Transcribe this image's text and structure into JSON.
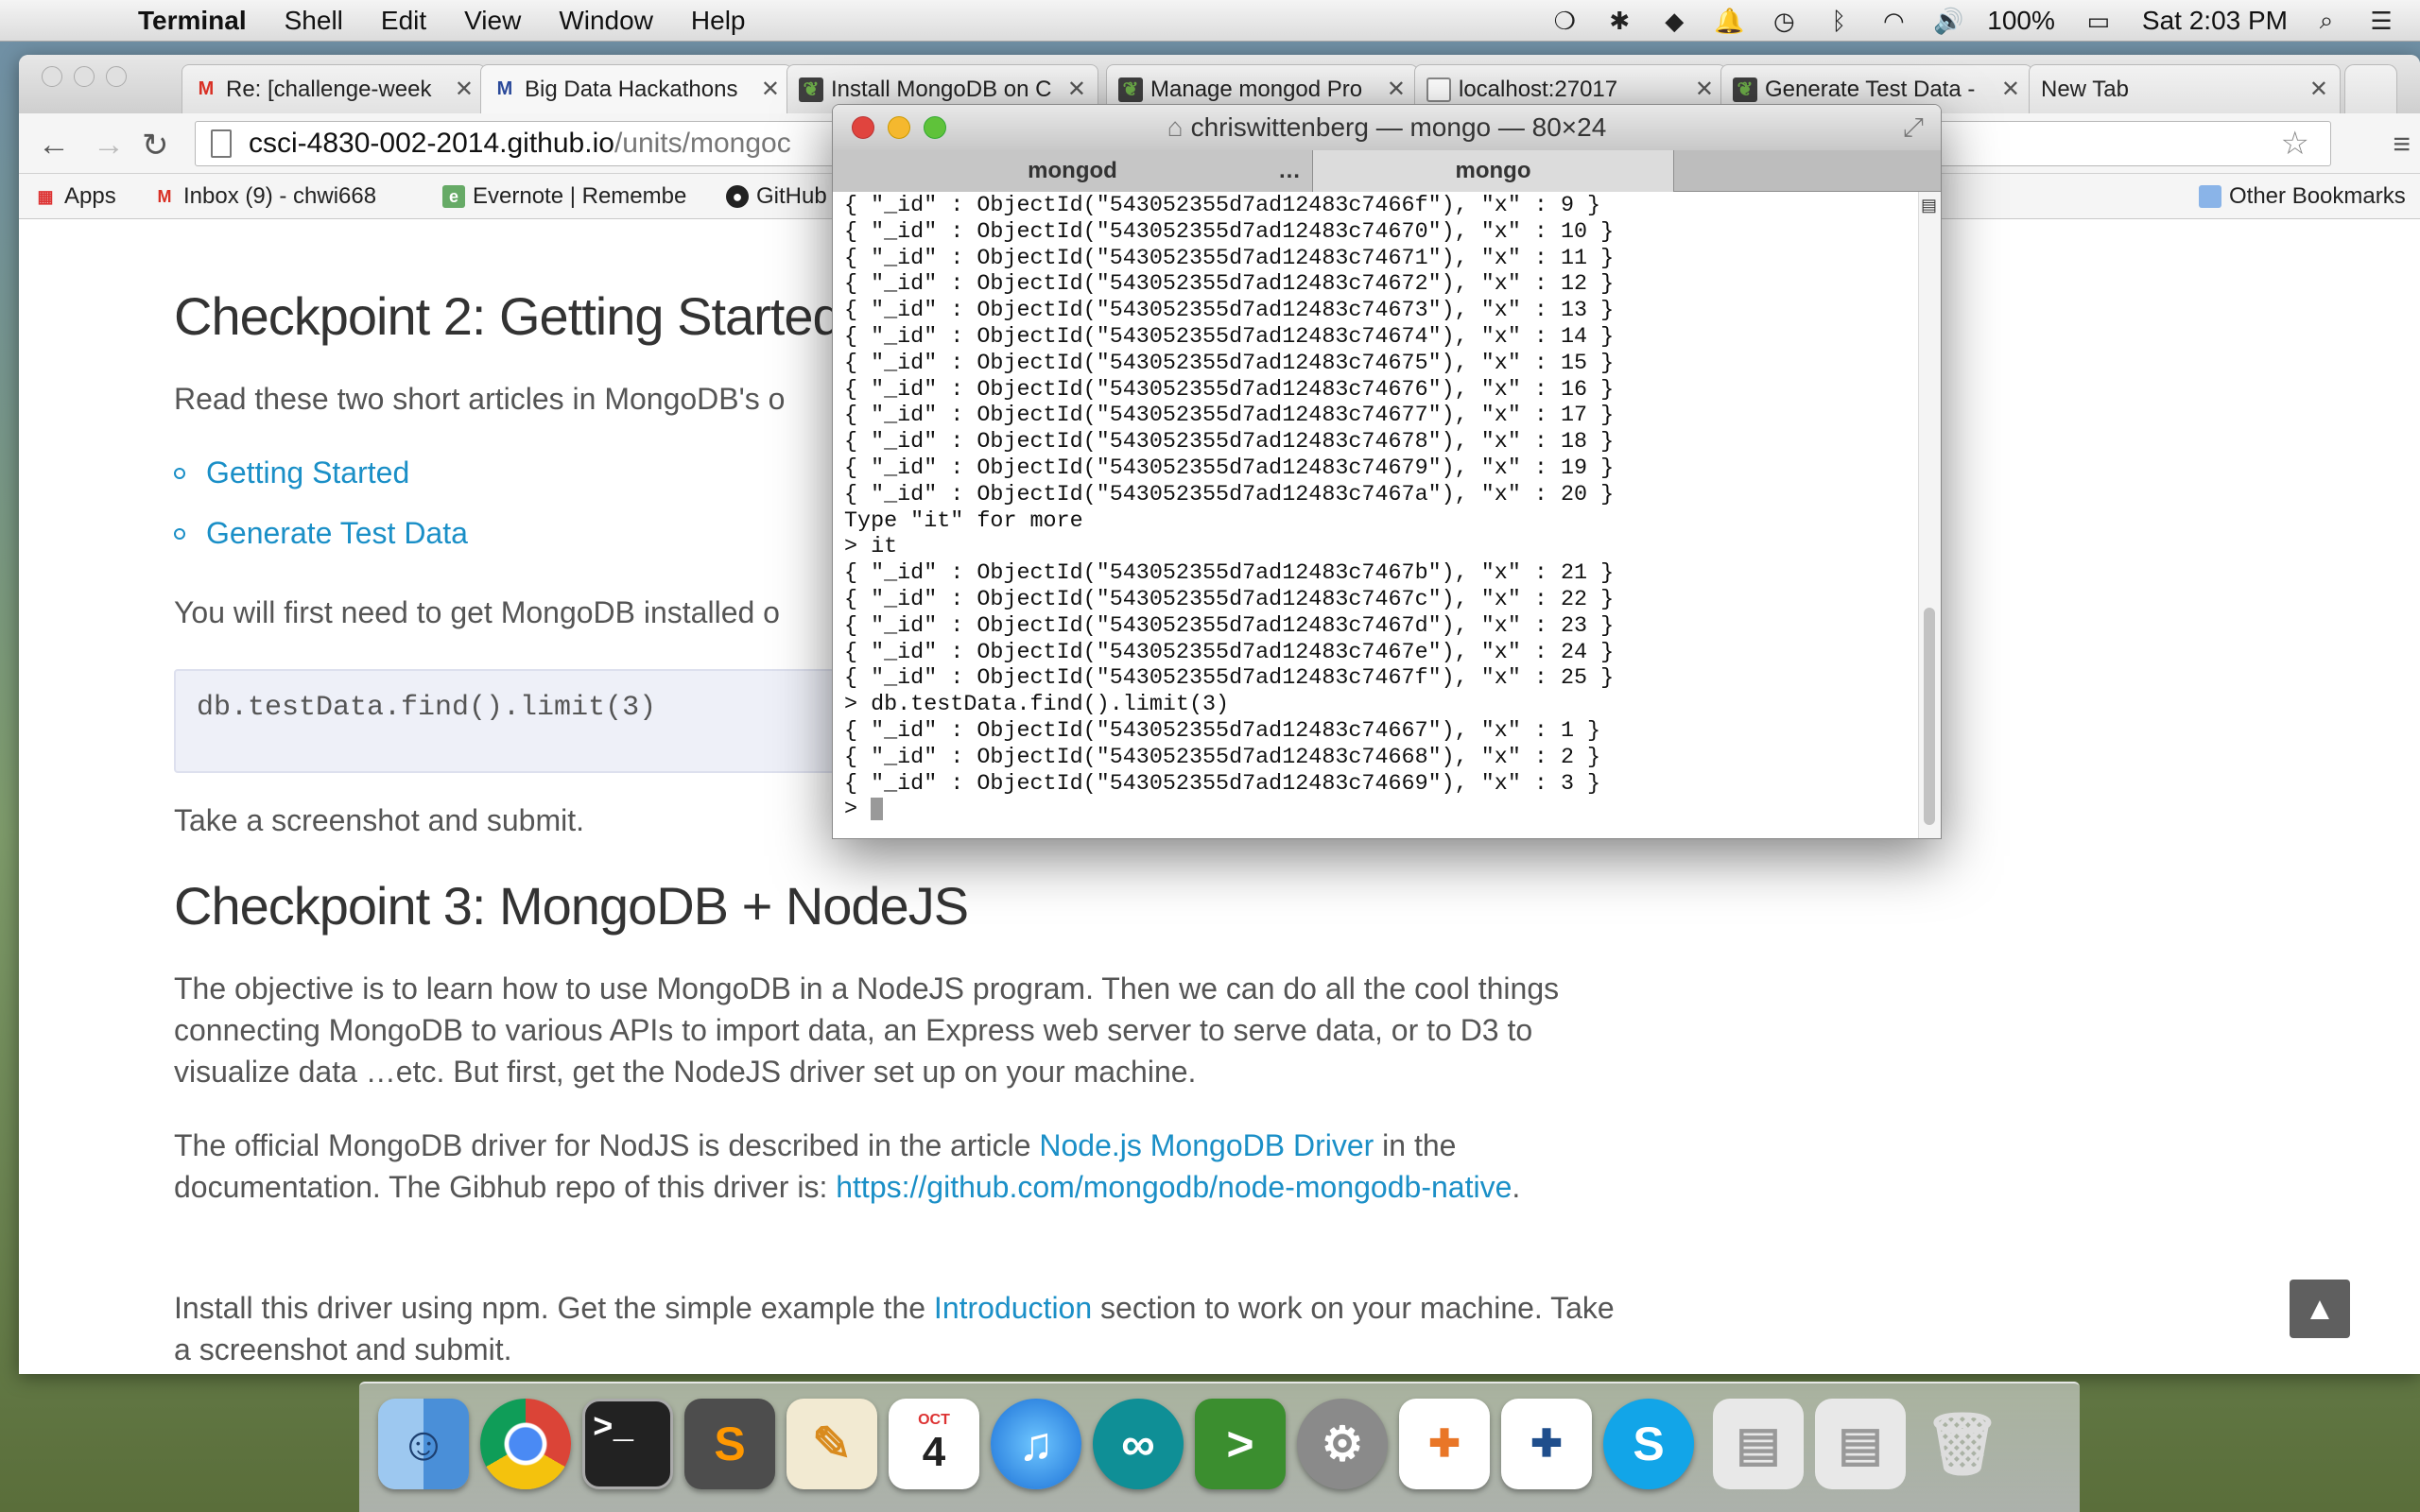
{
  "menubar": {
    "app_name": "Terminal",
    "items": [
      "Shell",
      "Edit",
      "View",
      "Window",
      "Help"
    ],
    "battery": "100%",
    "clock": "Sat 2:03 PM"
  },
  "chrome": {
    "tabs": [
      {
        "label": "Re: [challenge-week",
        "icon": "gmail-icon"
      },
      {
        "label": "Big Data Hackathons",
        "icon": "medium-icon"
      },
      {
        "label": "Install MongoDB on C",
        "icon": "mongodb-leaf-icon"
      },
      {
        "label": "Manage mongod Pro",
        "icon": "mongodb-leaf-icon"
      },
      {
        "label": "localhost:27017",
        "icon": "document-icon"
      },
      {
        "label": "Generate Test Data -",
        "icon": "mongodb-leaf-icon"
      },
      {
        "label": "New Tab",
        "icon": ""
      }
    ],
    "url_host": "csci-4830-002-2014.github.io",
    "url_path": "/units/mongoc",
    "bookmarks": [
      {
        "label": "Apps",
        "icon": "apps-grid-icon"
      },
      {
        "label": "Inbox (9) - chwi668",
        "icon": "gmail-icon"
      },
      {
        "label": "Evernote | Remembe",
        "icon": "evernote-icon"
      },
      {
        "label": "GitHub",
        "icon": "github-icon"
      },
      {
        "label": "Other Bookmarks",
        "icon": "folder-icon"
      }
    ]
  },
  "page": {
    "checkpoint2_title": "Checkpoint 2: Getting Started",
    "checkpoint2_intro": "Read these two short articles in MongoDB's o",
    "links": [
      "Getting Started",
      "Generate Test Data"
    ],
    "install_text": "You will first need to get MongoDB installed o",
    "code": "db.testData.find().limit(3)",
    "screenshot_text": "Take a screenshot and submit.",
    "checkpoint3_title": "Checkpoint 3: MongoDB + NodeJS",
    "objective_text": "The objective is to learn how to use MongoDB in a NodeJS program. Then we can do all the cool things connecting MongoDB to various APIs to import data, an Express web server to serve data, or to D3 to visualize data …etc. But first, get the NodeJS driver set up on your machine.",
    "driver_text_1": "The official MongoDB driver for NodJS is described in the article ",
    "driver_link": "Node.js MongoDB Driver",
    "driver_text_2": " in the documentation. The Gibhub repo of this driver is: ",
    "repo_link": "https://github.com/mongodb/node-mongodb-native",
    "driver_text_3": ".",
    "install_driver_1": "Install this driver using npm. Get the simple example the ",
    "intro_link": "Introduction",
    "install_driver_2": " section to work on your machine. Take a screenshot and submit."
  },
  "terminal": {
    "title": "chriswittenberg — mongo — 80×24",
    "tabs": [
      "mongod",
      "mongo"
    ],
    "tab_ellipsis": "…",
    "lines": [
      "{ \"_id\" : ObjectId(\"543052355d7ad12483c7466f\"), \"x\" : 9 }",
      "{ \"_id\" : ObjectId(\"543052355d7ad12483c74670\"), \"x\" : 10 }",
      "{ \"_id\" : ObjectId(\"543052355d7ad12483c74671\"), \"x\" : 11 }",
      "{ \"_id\" : ObjectId(\"543052355d7ad12483c74672\"), \"x\" : 12 }",
      "{ \"_id\" : ObjectId(\"543052355d7ad12483c74673\"), \"x\" : 13 }",
      "{ \"_id\" : ObjectId(\"543052355d7ad12483c74674\"), \"x\" : 14 }",
      "{ \"_id\" : ObjectId(\"543052355d7ad12483c74675\"), \"x\" : 15 }",
      "{ \"_id\" : ObjectId(\"543052355d7ad12483c74676\"), \"x\" : 16 }",
      "{ \"_id\" : ObjectId(\"543052355d7ad12483c74677\"), \"x\" : 17 }",
      "{ \"_id\" : ObjectId(\"543052355d7ad12483c74678\"), \"x\" : 18 }",
      "{ \"_id\" : ObjectId(\"543052355d7ad12483c74679\"), \"x\" : 19 }",
      "{ \"_id\" : ObjectId(\"543052355d7ad12483c7467a\"), \"x\" : 20 }",
      "Type \"it\" for more",
      "> it",
      "{ \"_id\" : ObjectId(\"543052355d7ad12483c7467b\"), \"x\" : 21 }",
      "{ \"_id\" : ObjectId(\"543052355d7ad12483c7467c\"), \"x\" : 22 }",
      "{ \"_id\" : ObjectId(\"543052355d7ad12483c7467d\"), \"x\" : 23 }",
      "{ \"_id\" : ObjectId(\"543052355d7ad12483c7467e\"), \"x\" : 24 }",
      "{ \"_id\" : ObjectId(\"543052355d7ad12483c7467f\"), \"x\" : 25 }",
      "> db.testData.find().limit(3)",
      "{ \"_id\" : ObjectId(\"543052355d7ad12483c74667\"), \"x\" : 1 }",
      "{ \"_id\" : ObjectId(\"543052355d7ad12483c74668\"), \"x\" : 2 }",
      "{ \"_id\" : ObjectId(\"543052355d7ad12483c74669\"), \"x\" : 3 }"
    ],
    "prompt": "> "
  },
  "dock": {
    "apps": [
      {
        "name": "finder-icon"
      },
      {
        "name": "chrome-icon"
      },
      {
        "name": "terminal-icon"
      },
      {
        "name": "sublime-text-icon"
      },
      {
        "name": "pages-icon"
      },
      {
        "name": "calendar-icon",
        "month": "OCT",
        "day": "4"
      },
      {
        "name": "itunes-icon"
      },
      {
        "name": "arduino-icon"
      },
      {
        "name": "cmd-prompt-icon"
      },
      {
        "name": "system-preferences-icon"
      },
      {
        "name": "tableau-icon"
      },
      {
        "name": "tableau-public-icon"
      },
      {
        "name": "skype-icon"
      },
      {
        "name": "downloads-stack-icon"
      },
      {
        "name": "documents-stack-icon"
      },
      {
        "name": "trash-icon"
      }
    ]
  }
}
